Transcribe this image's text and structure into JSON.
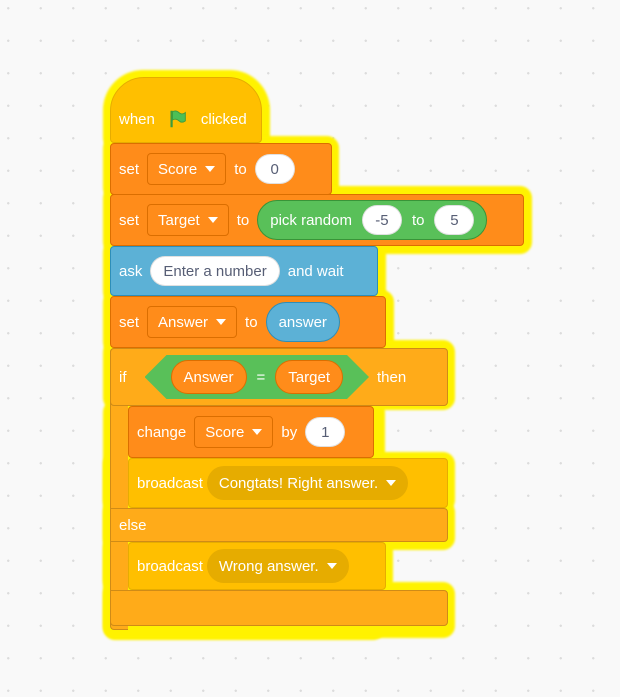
{
  "workspace": {
    "background": "#f9f9f9",
    "highlight_color": "#fff200"
  },
  "script": {
    "hat": {
      "when": "when",
      "flag_icon": "green-flag-icon",
      "clicked": "clicked"
    },
    "set_score": {
      "set": "set",
      "variable": "Score",
      "to": "to",
      "value": "0"
    },
    "set_target": {
      "set": "set",
      "variable": "Target",
      "to": "to",
      "reporter": {
        "label": "pick random",
        "from": "-5",
        "to_label": "to",
        "to": "5"
      }
    },
    "ask": {
      "ask": "ask",
      "question": "Enter a number",
      "and_wait": "and wait"
    },
    "set_answer": {
      "set": "set",
      "variable": "Answer",
      "to": "to",
      "reporter": "answer"
    },
    "if_else": {
      "if": "if",
      "then": "then",
      "else": "else",
      "condition": {
        "left": "Answer",
        "operator": "=",
        "right": "Target"
      },
      "then_blocks": {
        "change": {
          "change": "change",
          "variable": "Score",
          "by": "by",
          "value": "1"
        },
        "broadcast": {
          "label": "broadcast",
          "message": "Congtats! Right answer."
        }
      },
      "else_blocks": {
        "broadcast": {
          "label": "broadcast",
          "message": "Wrong answer."
        }
      }
    }
  },
  "colors": {
    "events": "#ffbf00",
    "variables": "#ff8c1a",
    "sensing": "#5cb1d6",
    "control": "#ffab19",
    "operators": "#59c059"
  }
}
